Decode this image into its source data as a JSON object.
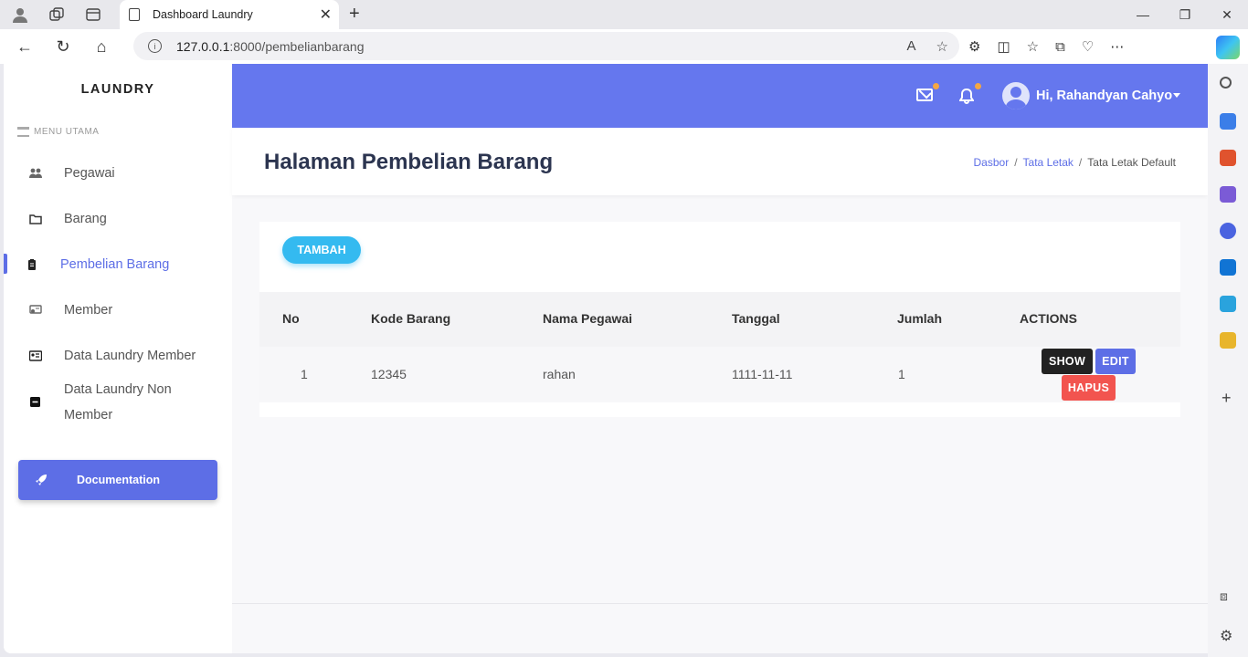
{
  "browser": {
    "tab_title": "Dashboard Laundry",
    "url_host": "127.0.0.1",
    "url_path": ":8000/pembelianbarang"
  },
  "sidebar": {
    "brand": "LAUNDRY",
    "menu_heading": "MENU UTAMA",
    "items": [
      {
        "label": "Pegawai"
      },
      {
        "label": "Barang"
      },
      {
        "label": "Pembelian Barang"
      },
      {
        "label": "Member"
      },
      {
        "label": "Data Laundry Member"
      },
      {
        "label": "Data Laundry Non Member"
      }
    ],
    "doc_button": "Documentation"
  },
  "topbar": {
    "greeting": "Hi, Rahandyan Cahyo"
  },
  "header": {
    "title": "Halaman Pembelian Barang",
    "breadcrumb": [
      "Dasbor",
      "Tata Letak",
      "Tata Letak Default"
    ]
  },
  "main": {
    "add_button": "TAMBAH",
    "columns": [
      "No",
      "Kode Barang",
      "Nama Pegawai",
      "Tanggal",
      "Jumlah",
      "ACTIONS"
    ],
    "rows": [
      {
        "no": "1",
        "kode": "12345",
        "nama": "rahan",
        "tanggal": "1111-11-11",
        "jumlah": "1"
      }
    ],
    "actions": {
      "show": "SHOW",
      "edit": "EDIT",
      "hapus": "HAPUS"
    }
  },
  "colors": {
    "primary": "#5d6ee6",
    "topbar": "#6577ee",
    "add": "#34baf0",
    "danger": "#f2544f"
  }
}
